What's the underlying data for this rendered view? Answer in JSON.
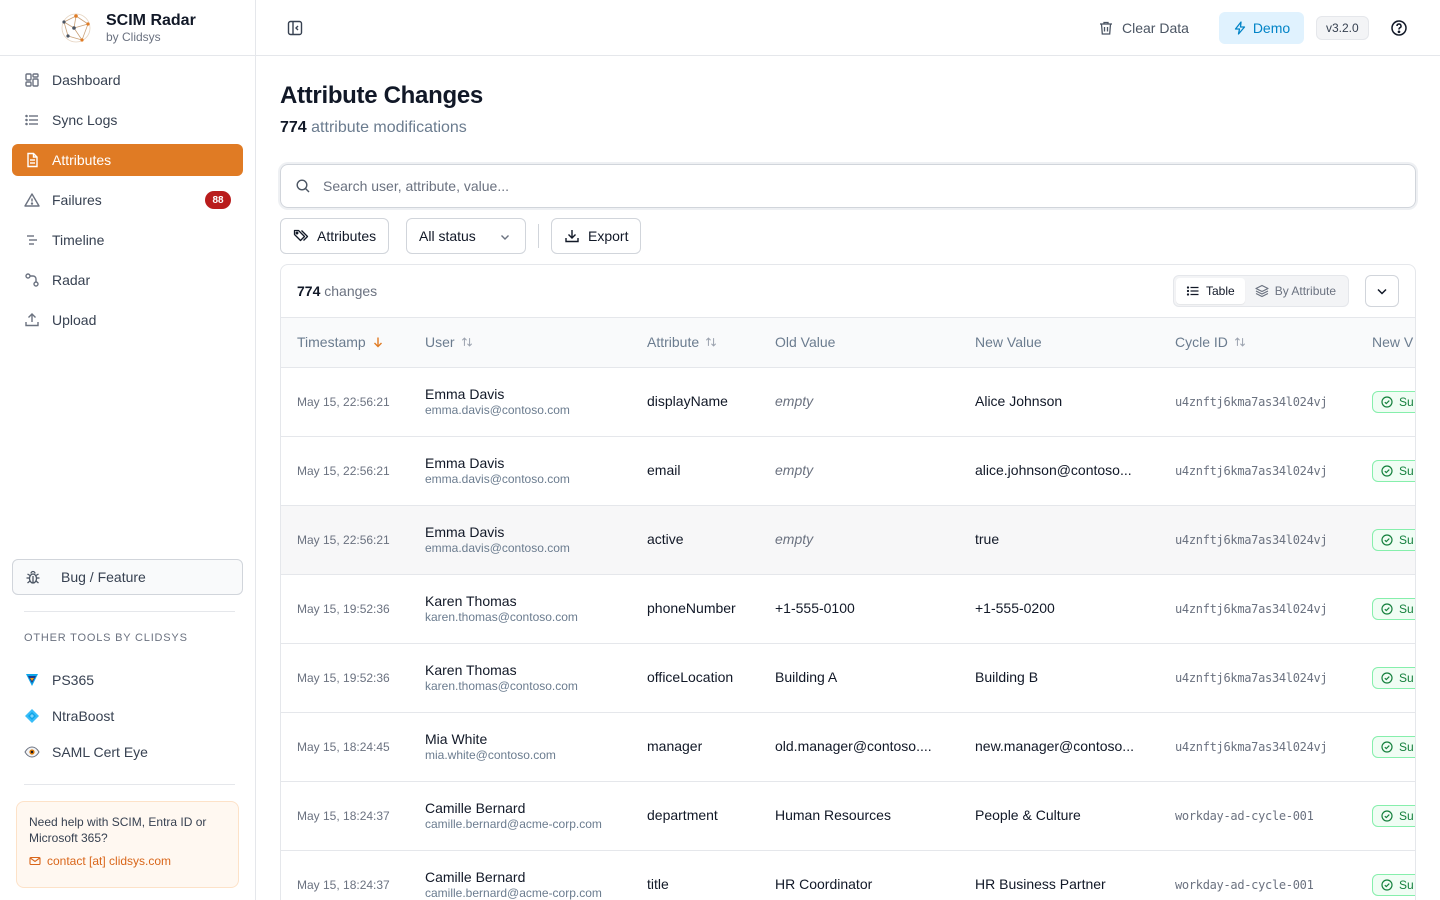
{
  "app": {
    "title": "SCIM Radar",
    "subtitle": "by Clidsys"
  },
  "sidebar": {
    "items": [
      {
        "label": "Dashboard",
        "icon": "dashboard-icon"
      },
      {
        "label": "Sync Logs",
        "icon": "list-icon"
      },
      {
        "label": "Attributes",
        "icon": "file-text-icon",
        "active": true
      },
      {
        "label": "Failures",
        "icon": "warning-icon",
        "badge": "88"
      },
      {
        "label": "Timeline",
        "icon": "timeline-icon"
      },
      {
        "label": "Radar",
        "icon": "radar-icon"
      },
      {
        "label": "Upload",
        "icon": "upload-icon"
      }
    ],
    "bug_label": "Bug / Feature",
    "other_tools_title": "OTHER TOOLS BY CLIDSYS",
    "tools": [
      {
        "label": "PS365"
      },
      {
        "label": "NtraBoost"
      },
      {
        "label": "SAML Cert Eye"
      }
    ],
    "help_text": "Need help with SCIM, Entra ID or Microsoft 365?",
    "help_contact": "contact [at] clidsys.com"
  },
  "header": {
    "clear_label": "Clear Data",
    "demo_label": "Demo",
    "version": "v3.2.0"
  },
  "page": {
    "title": "Attribute Changes",
    "count": "774",
    "count_suffix": "attribute modifications"
  },
  "search": {
    "placeholder": "Search user, attribute, value..."
  },
  "filters": {
    "attributes_label": "Attributes",
    "status_label": "All status",
    "export_label": "Export"
  },
  "table_card": {
    "count": "774",
    "count_suffix": "changes",
    "view_table": "Table",
    "view_by_attribute": "By Attribute"
  },
  "columns": {
    "timestamp": "Timestamp",
    "user": "User",
    "attribute": "Attribute",
    "old_value": "Old Value",
    "new_value": "New Value",
    "cycle_id": "Cycle ID",
    "status": "New V"
  },
  "rows": [
    {
      "ts": "May 15, 22:56:21",
      "name": "Emma Davis",
      "email": "emma.davis@contoso.com",
      "attr": "displayName",
      "old": "empty",
      "new": "Alice Johnson",
      "cycle": "u4znftj6kma7as34l024vj",
      "status": "Su"
    },
    {
      "ts": "May 15, 22:56:21",
      "name": "Emma Davis",
      "email": "emma.davis@contoso.com",
      "attr": "email",
      "old": "empty",
      "new": "alice.johnson@contoso...",
      "cycle": "u4znftj6kma7as34l024vj",
      "status": "Su"
    },
    {
      "ts": "May 15, 22:56:21",
      "name": "Emma Davis",
      "email": "emma.davis@contoso.com",
      "attr": "active",
      "old": "empty",
      "new": "true",
      "cycle": "u4znftj6kma7as34l024vj",
      "status": "Su"
    },
    {
      "ts": "May 15, 19:52:36",
      "name": "Karen Thomas",
      "email": "karen.thomas@contoso.com",
      "attr": "phoneNumber",
      "old": "+1-555-0100",
      "new": "+1-555-0200",
      "cycle": "u4znftj6kma7as34l024vj",
      "status": "Su"
    },
    {
      "ts": "May 15, 19:52:36",
      "name": "Karen Thomas",
      "email": "karen.thomas@contoso.com",
      "attr": "officeLocation",
      "old": "Building A",
      "new": "Building B",
      "cycle": "u4znftj6kma7as34l024vj",
      "status": "Su"
    },
    {
      "ts": "May 15, 18:24:45",
      "name": "Mia White",
      "email": "mia.white@contoso.com",
      "attr": "manager",
      "old": "old.manager@contoso....",
      "new": "new.manager@contoso...",
      "cycle": "u4znftj6kma7as34l024vj",
      "status": "Su"
    },
    {
      "ts": "May 15, 18:24:37",
      "name": "Camille Bernard",
      "email": "camille.bernard@acme-corp.com",
      "attr": "department",
      "old": "Human Resources",
      "new": "People & Culture",
      "cycle": "workday-ad-cycle-001",
      "status": "Su"
    },
    {
      "ts": "May 15, 18:24:37",
      "name": "Camille Bernard",
      "email": "camille.bernard@acme-corp.com",
      "attr": "title",
      "old": "HR Coordinator",
      "new": "HR Business Partner",
      "cycle": "workday-ad-cycle-001",
      "status": "Su"
    }
  ],
  "colors": {
    "accent": "#e07b24",
    "badge": "#b91c1c",
    "demo": "#0284c7",
    "success": "#15803d"
  }
}
